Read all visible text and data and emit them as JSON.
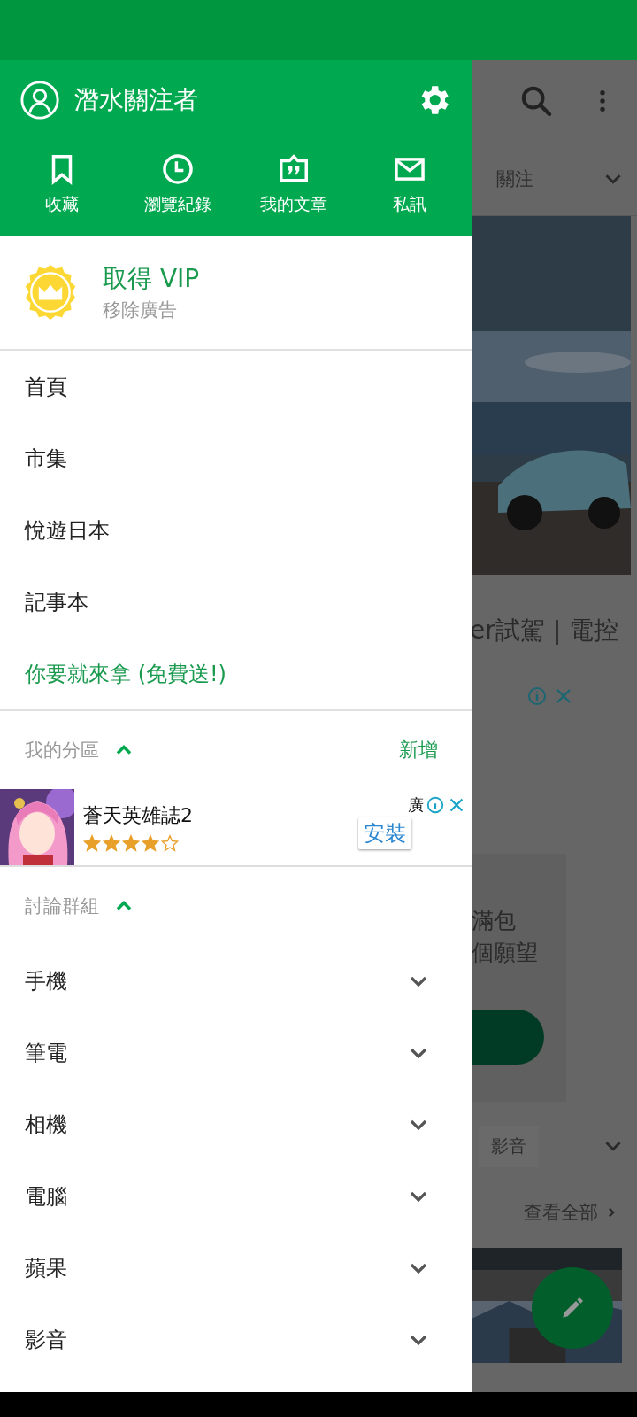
{
  "header": {
    "username": "潛水關注者",
    "shortcuts": [
      {
        "kind": "bookmark",
        "label": "收藏"
      },
      {
        "kind": "history",
        "label": "瀏覽紀錄"
      },
      {
        "kind": "article",
        "label": "我的文章"
      },
      {
        "kind": "message",
        "label": "私訊"
      }
    ]
  },
  "vip": {
    "title": "取得 VIP",
    "subtitle": "移除廣告"
  },
  "menu": [
    {
      "label": "首頁",
      "kind": "plain"
    },
    {
      "label": "市集",
      "kind": "plain"
    },
    {
      "label": "悅遊日本",
      "kind": "plain"
    },
    {
      "label": "記事本",
      "kind": "plain"
    },
    {
      "label": "你要就來拿 (免費送!)",
      "kind": "promo"
    }
  ],
  "my_boards": {
    "title": "我的分區",
    "expanded": true,
    "action": "新增"
  },
  "ad": {
    "title": "蒼天英雄誌2",
    "stars": 4,
    "button": "安裝",
    "badge": "廣"
  },
  "groups": {
    "title": "討論群組",
    "expanded": true,
    "items": [
      {
        "label": "手機",
        "expanded": false
      },
      {
        "label": "筆電",
        "expanded": false
      },
      {
        "label": "相機",
        "expanded": false
      },
      {
        "label": "電腦",
        "expanded": false
      },
      {
        "label": "蘋果",
        "expanded": false
      },
      {
        "label": "影音",
        "expanded": false
      }
    ]
  },
  "background": {
    "tabs": [
      "關注"
    ],
    "headline": "er試駕｜電控",
    "card_lines": [
      "滿包",
      "個願望"
    ],
    "chips": [
      "影音"
    ],
    "view_all": "查看全部"
  }
}
